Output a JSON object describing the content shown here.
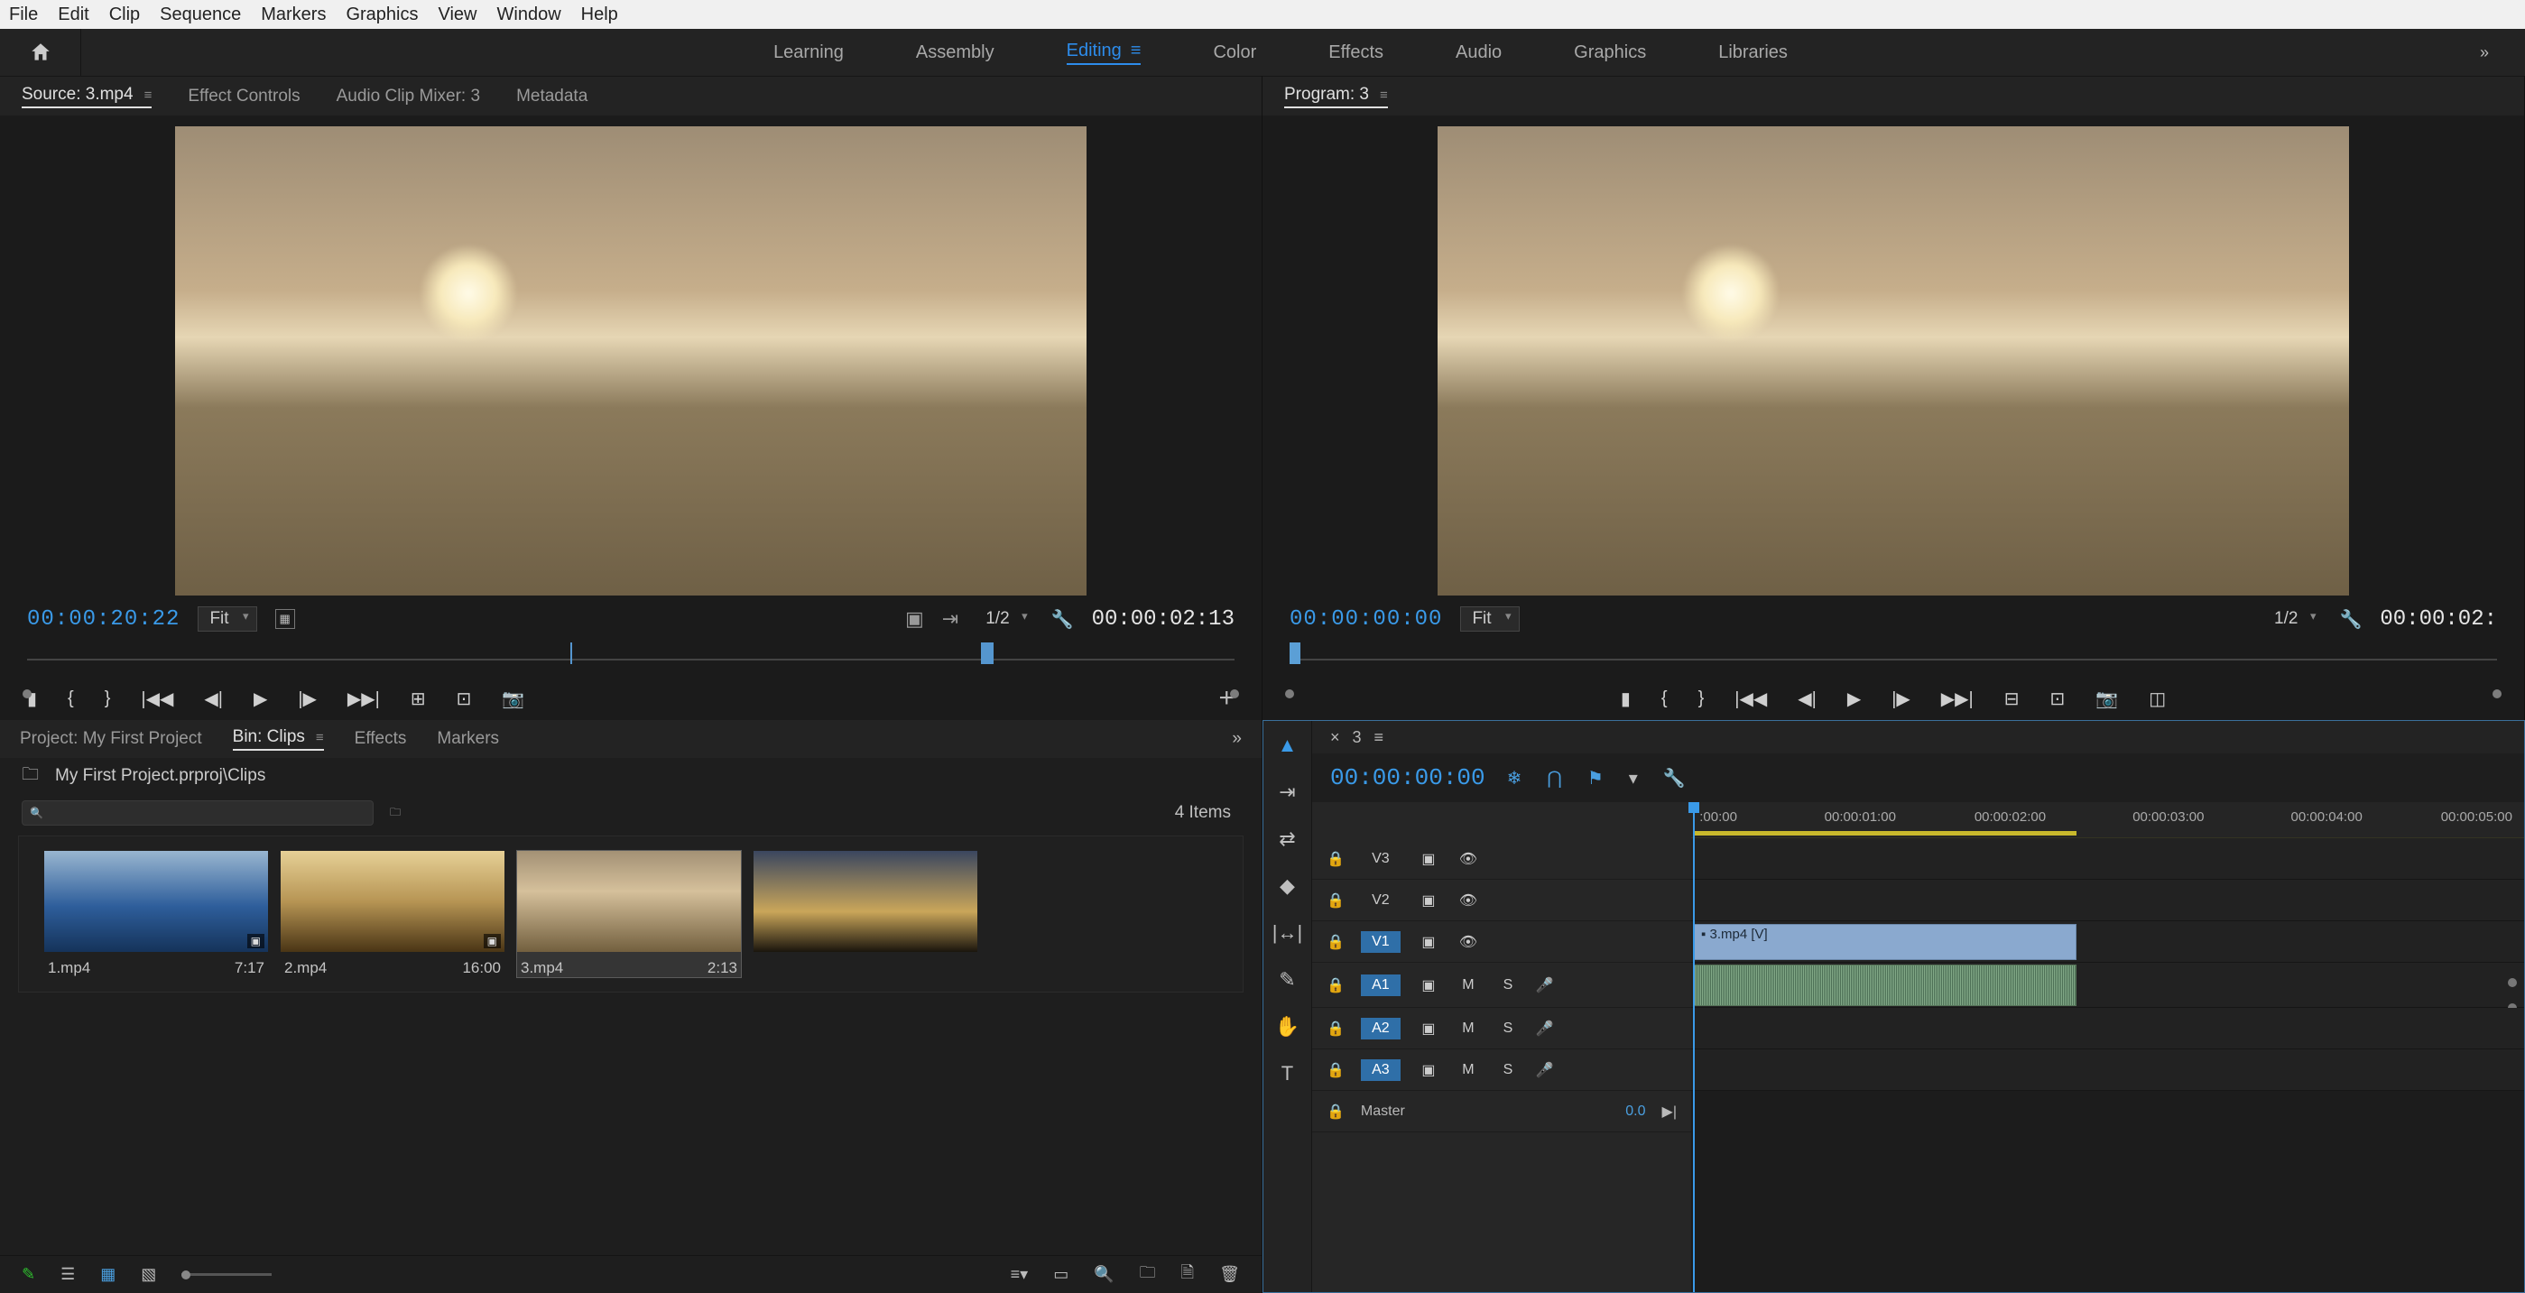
{
  "menu": [
    "File",
    "Edit",
    "Clip",
    "Sequence",
    "Markers",
    "Graphics",
    "View",
    "Window",
    "Help"
  ],
  "workspaces": {
    "items": [
      "Learning",
      "Assembly",
      "Editing",
      "Color",
      "Effects",
      "Audio",
      "Graphics",
      "Libraries"
    ],
    "active": "Editing"
  },
  "source_panel": {
    "tabs": [
      "Source: 3.mp4",
      "Effect Controls",
      "Audio Clip Mixer: 3",
      "Metadata"
    ],
    "active": 0,
    "timecode": "00:00:20:22",
    "fit": "Fit",
    "resolution": "1/2",
    "duration": "00:00:02:13"
  },
  "program_panel": {
    "tab": "Program: 3",
    "timecode": "00:00:00:00",
    "fit": "Fit",
    "resolution": "1/2",
    "duration": "00:00:02:"
  },
  "project_panel": {
    "tabs": [
      "Project: My First Project",
      "Bin: Clips",
      "Effects",
      "Markers"
    ],
    "active": 1,
    "path": "My First Project.prproj\\Clips",
    "items_count": "4 Items",
    "clips": [
      {
        "name": "1.mp4",
        "dur": "7:17"
      },
      {
        "name": "2.mp4",
        "dur": "16:00"
      },
      {
        "name": "3.mp4",
        "dur": "2:13"
      },
      {
        "name": "",
        "dur": ""
      }
    ]
  },
  "timeline": {
    "sequence": "3",
    "timecode": "00:00:00:00",
    "ruler": [
      ":00:00",
      "00:00:01:00",
      "00:00:02:00",
      "00:00:03:00",
      "00:00:04:00",
      "00:00:05:00"
    ],
    "tracks_video": [
      "V3",
      "V2",
      "V1"
    ],
    "tracks_audio": [
      "A1",
      "A2",
      "A3"
    ],
    "master_label": "Master",
    "master_val": "0.0",
    "clip_v_label": "3.mp4 [V]",
    "mute": "M",
    "solo": "S"
  }
}
